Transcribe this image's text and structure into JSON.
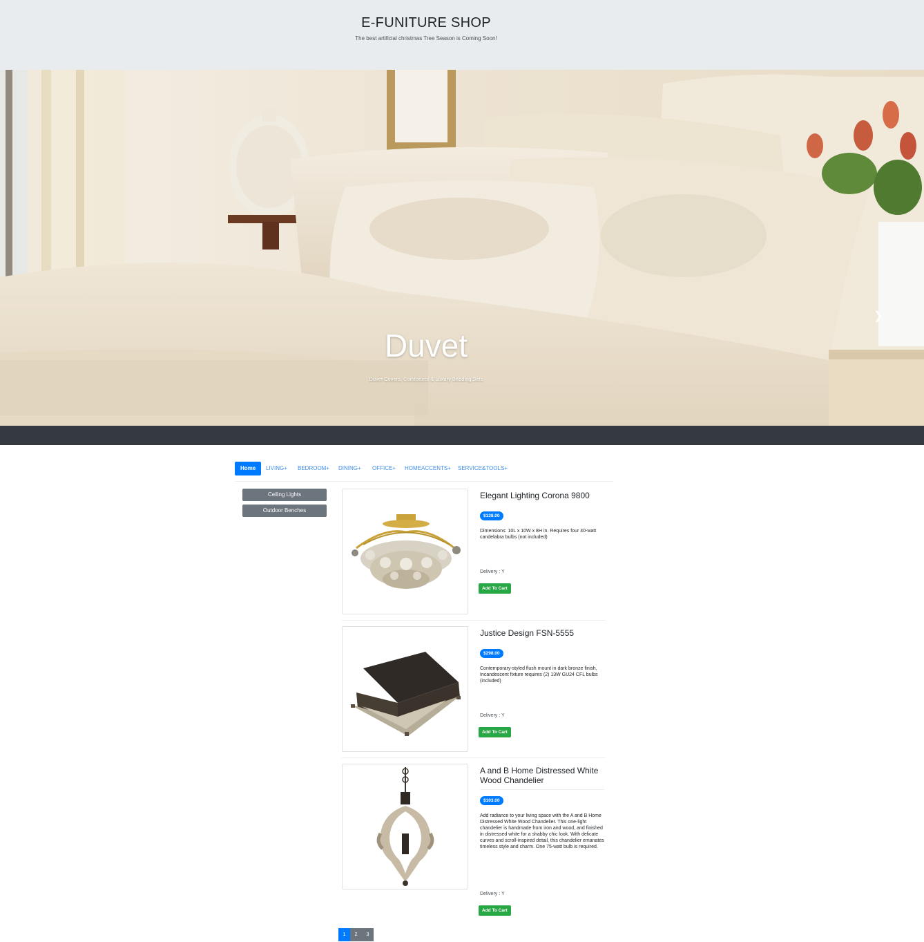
{
  "header": {
    "title": "E-FUNITURE SHOP",
    "tagline": "The best artificial christmas Tree Season is Coming Soon!"
  },
  "hero": {
    "caption_title": "Duvet",
    "caption_sub": "Duvet Covers, Comforters & Luxury Bedding Sets",
    "next_icon": "chevron-right-icon",
    "slide_count": 3,
    "active_slide": 2
  },
  "nav": {
    "tabs": [
      {
        "label": "Home",
        "active": true
      },
      {
        "label": "LIVING+"
      },
      {
        "label": "BEDROOM+"
      },
      {
        "label": "DINING+"
      },
      {
        "label": "OFFICE+"
      },
      {
        "label": "HOMEACCENTS+"
      },
      {
        "label": "SERVICE&TOOLS+"
      }
    ]
  },
  "sidebar": {
    "items": [
      {
        "label": "Ceiling Lights"
      },
      {
        "label": "Outdoor Benches"
      }
    ]
  },
  "products": [
    {
      "name": "Elegant Lighting Corona 9800",
      "price": "$138.00",
      "description": "Dimensions: 10L x 10W x 8H in. Requires four 40-watt candelabra bulbs (not included)",
      "delivery": "Delivery : Y",
      "cart_label": "Add To Cart"
    },
    {
      "name": "Justice Design FSN-5555",
      "price": "$298.00",
      "description": "Contemporary-styled flush mount in dark bronze finish, Incandescent fixture requires (2) 13W GU24 CFL bulbs (included)",
      "delivery": "Delivery : Y",
      "cart_label": "Add To Cart"
    },
    {
      "name": "A and B Home Distressed White Wood Chandelier",
      "price": "$103.00",
      "description": "Add radiance to your living space with the A and B Home Distressed White Wood Chandelier. This one-light chandelier is handmade from iron and wood, and finished in distressed white for a shabby chic look. With delicate curves and scroll-inspired detail, this chandelier emanates timeless style and charm. One 75-watt bulb is required.",
      "delivery": "Delivery : Y",
      "cart_label": "Add To Cart"
    }
  ],
  "pagination": {
    "pages": [
      "1",
      "2",
      "3"
    ],
    "current": "1"
  },
  "colors": {
    "primary": "#007bff",
    "success": "#28a745",
    "secondary": "#6c757d",
    "dark": "#343a40",
    "header_bg": "#e9ecef"
  }
}
